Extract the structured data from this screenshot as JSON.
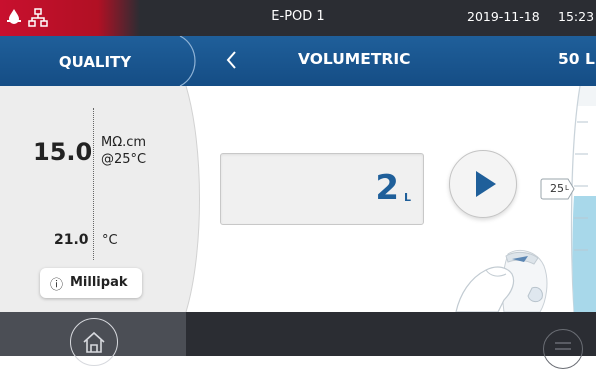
{
  "status_bar": {
    "device_name": "E-POD 1",
    "date": "2019-11-18",
    "time": "15:23",
    "icons": [
      "water-drop-alert-icon",
      "network-icon"
    ]
  },
  "header": {
    "left_title": "QUALITY",
    "title": "VOLUMETRIC",
    "right_value": "50 L",
    "back_icon": "chevron-left-icon"
  },
  "quality": {
    "resistivity_value": "15.0",
    "resistivity_unit": "MΩ.cm",
    "resistivity_ref": "@25°C",
    "temperature_value": "21.0",
    "temperature_unit": "°C",
    "info_symbol": "ⓘ",
    "filter_label": "Millipak"
  },
  "volumetric": {
    "volume_value": "2",
    "volume_unit": "L",
    "play_icon": "play-icon",
    "tank_marker_value": "25",
    "tank_marker_unit": "L"
  },
  "footer": {
    "home_icon": "home-icon",
    "menu_icon": "menu-icon"
  },
  "colors": {
    "brand_red": "#c8102e",
    "header_blue": "#1f5f9a",
    "accent_blue": "#1f5f9a",
    "water_blue": "#a8d8ea",
    "dark_bar": "#2b2d33"
  }
}
